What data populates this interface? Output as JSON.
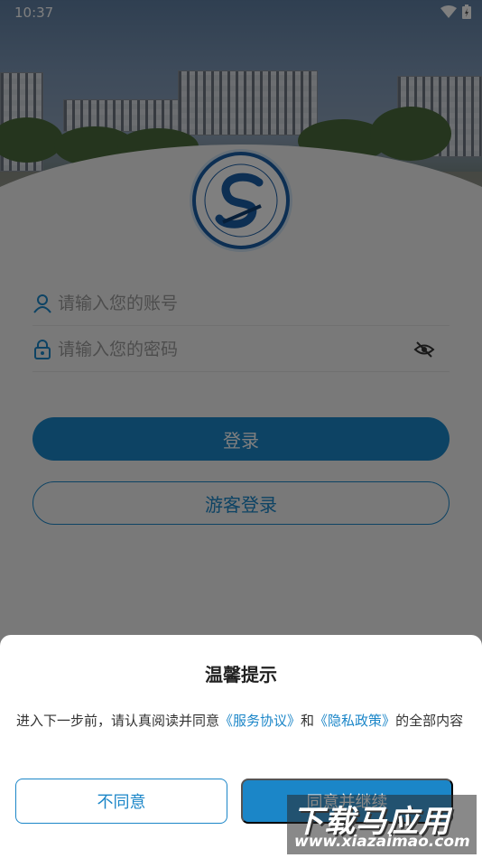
{
  "status_bar": {
    "time": "10:37"
  },
  "login_form": {
    "account_placeholder": "请输入您的账号",
    "password_placeholder": "请输入您的密码",
    "login_label": "登录",
    "guest_login_label": "游客登录"
  },
  "dialog": {
    "title": "温馨提示",
    "text_before": "进入下一步前，请认真阅读并同意",
    "service_link": "《服务协议》",
    "text_and": "和",
    "privacy_link": "《隐私政策》",
    "text_after": "的全部内容",
    "disagree_label": "不同意",
    "agree_label": "同意并继续"
  },
  "watermark": {
    "line1": "下载马应用",
    "line2": "www.xiazaimao.com"
  },
  "colors": {
    "accent": "#1b86c8",
    "logo_ring": "#1b5ea6"
  }
}
